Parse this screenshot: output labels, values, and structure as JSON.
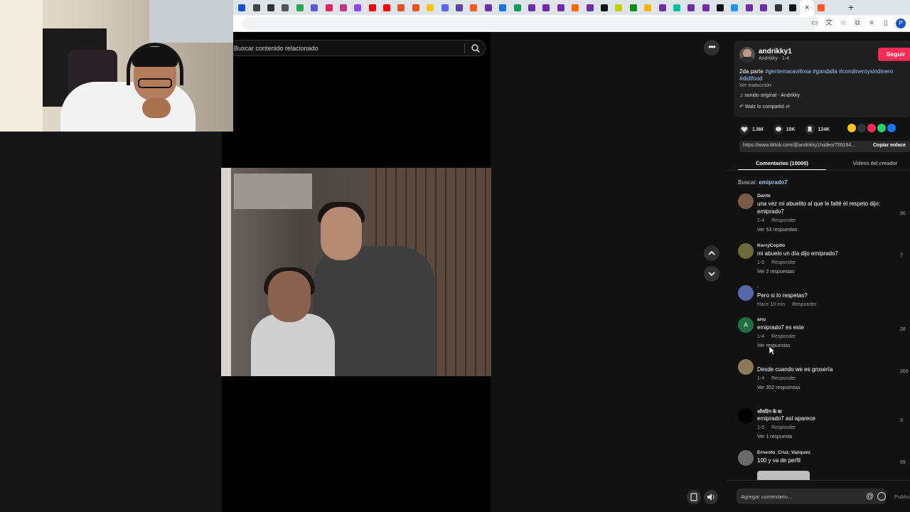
{
  "browser": {
    "tab_colors": [
      "#1c4fd6",
      "#444",
      "#333",
      "#555",
      "#2aa84f",
      "#5b5bd6",
      "#e0245e",
      "#c13584",
      "#9146ff",
      "#ff0000",
      "#ff0000",
      "#e34f26",
      "#f04e23",
      "#f5c518",
      "#5865f2",
      "#6441a5",
      "#ff5722",
      "#6f2da8",
      "#1a73e8",
      "#0f9d58",
      "#6f2da8",
      "#6f2da8",
      "#6f2da8",
      "#ff6600",
      "#6f2da8",
      "#111",
      "#c0d400",
      "#0e8a16",
      "#f4b400",
      "#6f2da8",
      "#00bfa5",
      "#6f2da8",
      "#6f2da8",
      "#111",
      "#2196f3",
      "#6f2da8",
      "#6f2da8",
      "#333",
      "#111",
      "#ff5722"
    ],
    "active_tab_close": "×",
    "new_tab": "+",
    "profile_initial": "P"
  },
  "search": {
    "placeholder": "Buscar contenido relacionado"
  },
  "controls": {
    "more": "•••"
  },
  "author": {
    "username": "andrikky1",
    "subline": "Andrikky · 1-4",
    "follow": "Seguir"
  },
  "description": {
    "prefix": "2da parte ",
    "hashtags_line1": "#gentemaravillosa #gandalla #condineroysindinero",
    "hashtags_line2": "#didifood",
    "translate": "Ver traducción",
    "sound": "♫  sonido original - Andrikky",
    "shared": "↶ Walz lo compartió  ⇄"
  },
  "stats": {
    "likes": "1.8M",
    "comments": "10K",
    "saves": "134K"
  },
  "share_colors": [
    "#f5c518",
    "#333",
    "#fe2c55",
    "#25d366",
    "#1877f2"
  ],
  "link": {
    "url": "https://www.tiktok.com/@andrikky1/video/759164...",
    "copy": "Copiar enlace"
  },
  "tabs": {
    "comments": "Comentarios (10000)",
    "videos": "Videos del creador"
  },
  "search_hint": {
    "label": "Buscar: ",
    "term": "emiprado7"
  },
  "comments": [
    {
      "name": "Dante",
      "text": "una vez mi abuelito al que le falté el respeto dijo: emiprado7",
      "date": "1-4",
      "reply": "Responder",
      "more": "Ver 53 respuestas",
      "likes": "96",
      "avatar_color": "#7a5a4a"
    },
    {
      "name": "KerryCopito",
      "text": "mi abuelo un día dijo emiprado7",
      "date": "1-5",
      "reply": "Responder",
      "more": "Ver 2 respuestas",
      "likes": "7",
      "avatar_color": "#6b6b3a"
    },
    {
      "name": "·",
      "text": "Pero si lo respetas?",
      "date": "Hace 10 min",
      "reply": "Responder",
      "more": "",
      "likes": "",
      "avatar_color": "#5566aa"
    },
    {
      "name": "anu",
      "text": "emiprado7 es este",
      "date": "1-4",
      "reply": "Responder",
      "more": "Ver respuestas",
      "likes": "28",
      "avatar_color": "#1f6f43",
      "initial": "A"
    },
    {
      "name": "",
      "text": "Desde cuando we es grosería",
      "date": "1-4",
      "reply": "Responder",
      "more": "Ver 352 respuestas",
      "likes": "266",
      "avatar_color": "#8a7a55"
    },
    {
      "name": "ओमटिन के बा",
      "text": "emiprado7 así aparece",
      "date": "1-5",
      "reply": "Responder",
      "more": "Ver 1 respuesta",
      "likes": "3",
      "avatar_color": "#000"
    },
    {
      "name": "Ernesto_Cruz_Vazquez",
      "text": "100 y va de perfil",
      "date": "",
      "reply": "",
      "more": "",
      "likes": "89",
      "avatar_color": "#6a6a6a"
    }
  ],
  "comment_box": {
    "placeholder": "Agregar comentario...",
    "at": "@",
    "publish": "Publicar"
  }
}
